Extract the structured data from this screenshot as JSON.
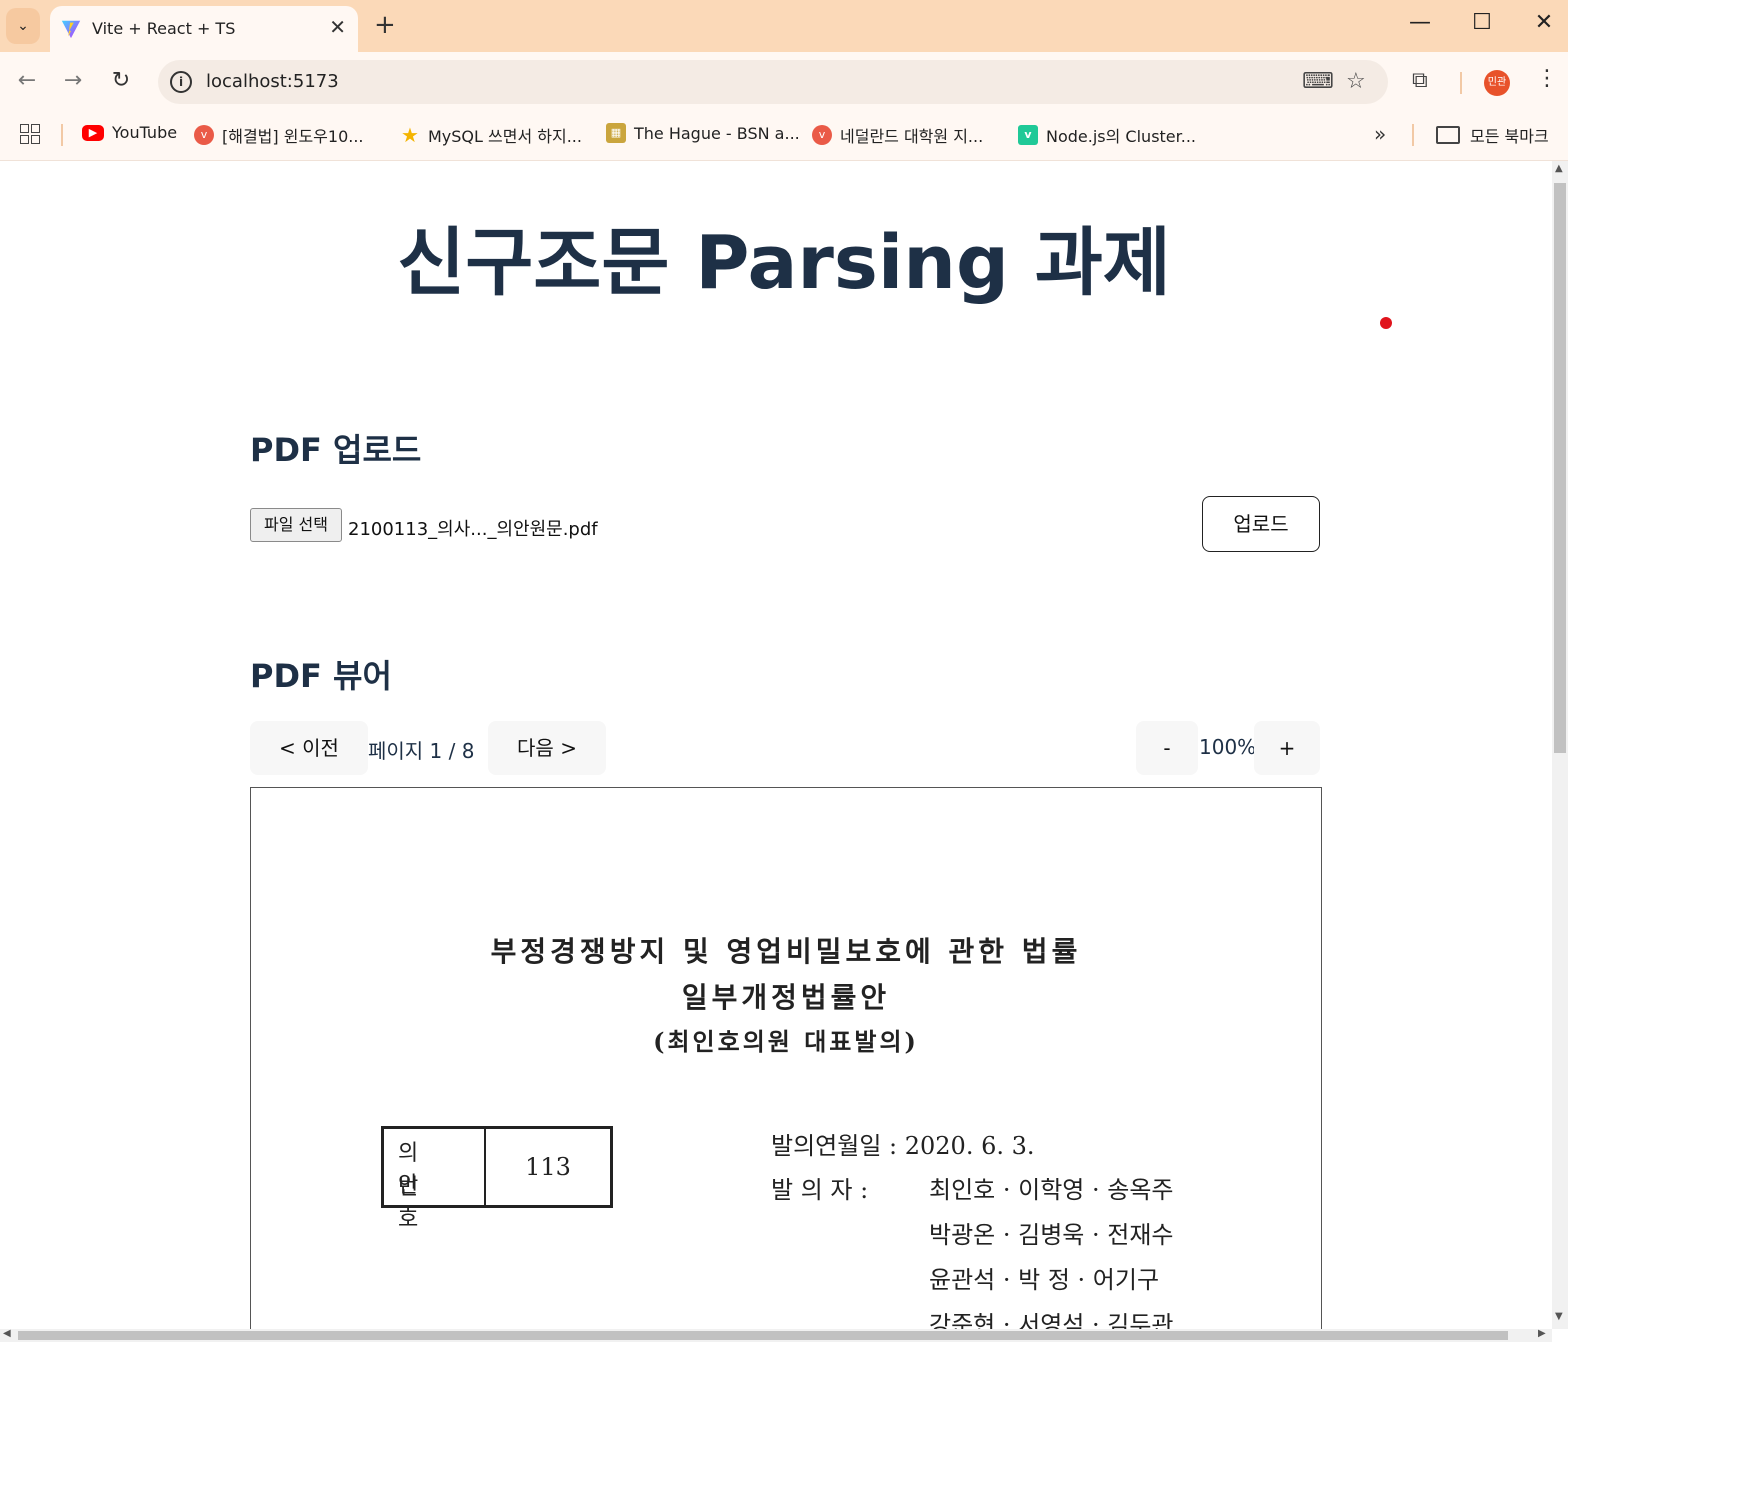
{
  "browser": {
    "tab_title": "Vite + React + TS",
    "tab_close": "✕",
    "new_tab": "+",
    "url": "localhost:5173",
    "profile_initials": "민관",
    "window_controls": {
      "minimize": "—",
      "maximize": "☐",
      "close": "✕"
    },
    "bookmarks": [
      {
        "label": "YouTube",
        "icon": "youtube-icon",
        "color": "#ff0000"
      },
      {
        "label": "[해결법] 윈도우10...",
        "icon": "vite-icon",
        "color": "#ea5a47"
      },
      {
        "label": "MySQL 쓰면서 하지...",
        "icon": "star-icon",
        "color": "#f4b400"
      },
      {
        "label": "The Hague - BSN a...",
        "icon": "city-icon",
        "color": "#caa53d"
      },
      {
        "label": "네덜란드 대학원 지...",
        "icon": "vite-icon",
        "color": "#ea5a47"
      },
      {
        "label": "Node.js의 Cluster...",
        "icon": "velog-icon",
        "color": "#20c997"
      }
    ],
    "more_bookmarks": "»",
    "all_bookmarks": "모든 북마크"
  },
  "page": {
    "title": "신구조문 Parsing 과제",
    "upload": {
      "heading": "PDF 업로드",
      "file_button": "파일 선택",
      "file_name": "2100113_의사..._의안원문.pdf",
      "upload_button": "업로드"
    },
    "viewer": {
      "heading": "PDF 뷰어",
      "prev_button": "< 이전",
      "page_label": "페이지 1 / 8",
      "next_button": "다음 >",
      "zoom_out": "-",
      "zoom_level": "100%",
      "zoom_in": "+"
    },
    "document": {
      "title_line1": "부정경쟁방지 및 영업비밀보호에 관한 법률",
      "title_line2": "일부개정법률안",
      "sponsor": "(최인호의원 대표발의)",
      "bill_label_line1": "의 안",
      "bill_label_line2": "번 호",
      "bill_number": "113",
      "date_label": "발의연월일 : 2020.  6.  3.",
      "proposer_label": "발    의    자 :",
      "proposers_1": "최인호 · 이학영 · 송옥주",
      "proposers_2": "박광온 · 김병욱 · 전재수",
      "proposers_3": "윤관석 · 박    정 · 어기구",
      "proposers_4": "강준현 · 서영석 · 김두관"
    }
  },
  "colors": {
    "tab_strip": "#fbd9b8",
    "toolbar": "#fff8f3",
    "heading": "#1e3046",
    "indicator": "#e0141c"
  }
}
